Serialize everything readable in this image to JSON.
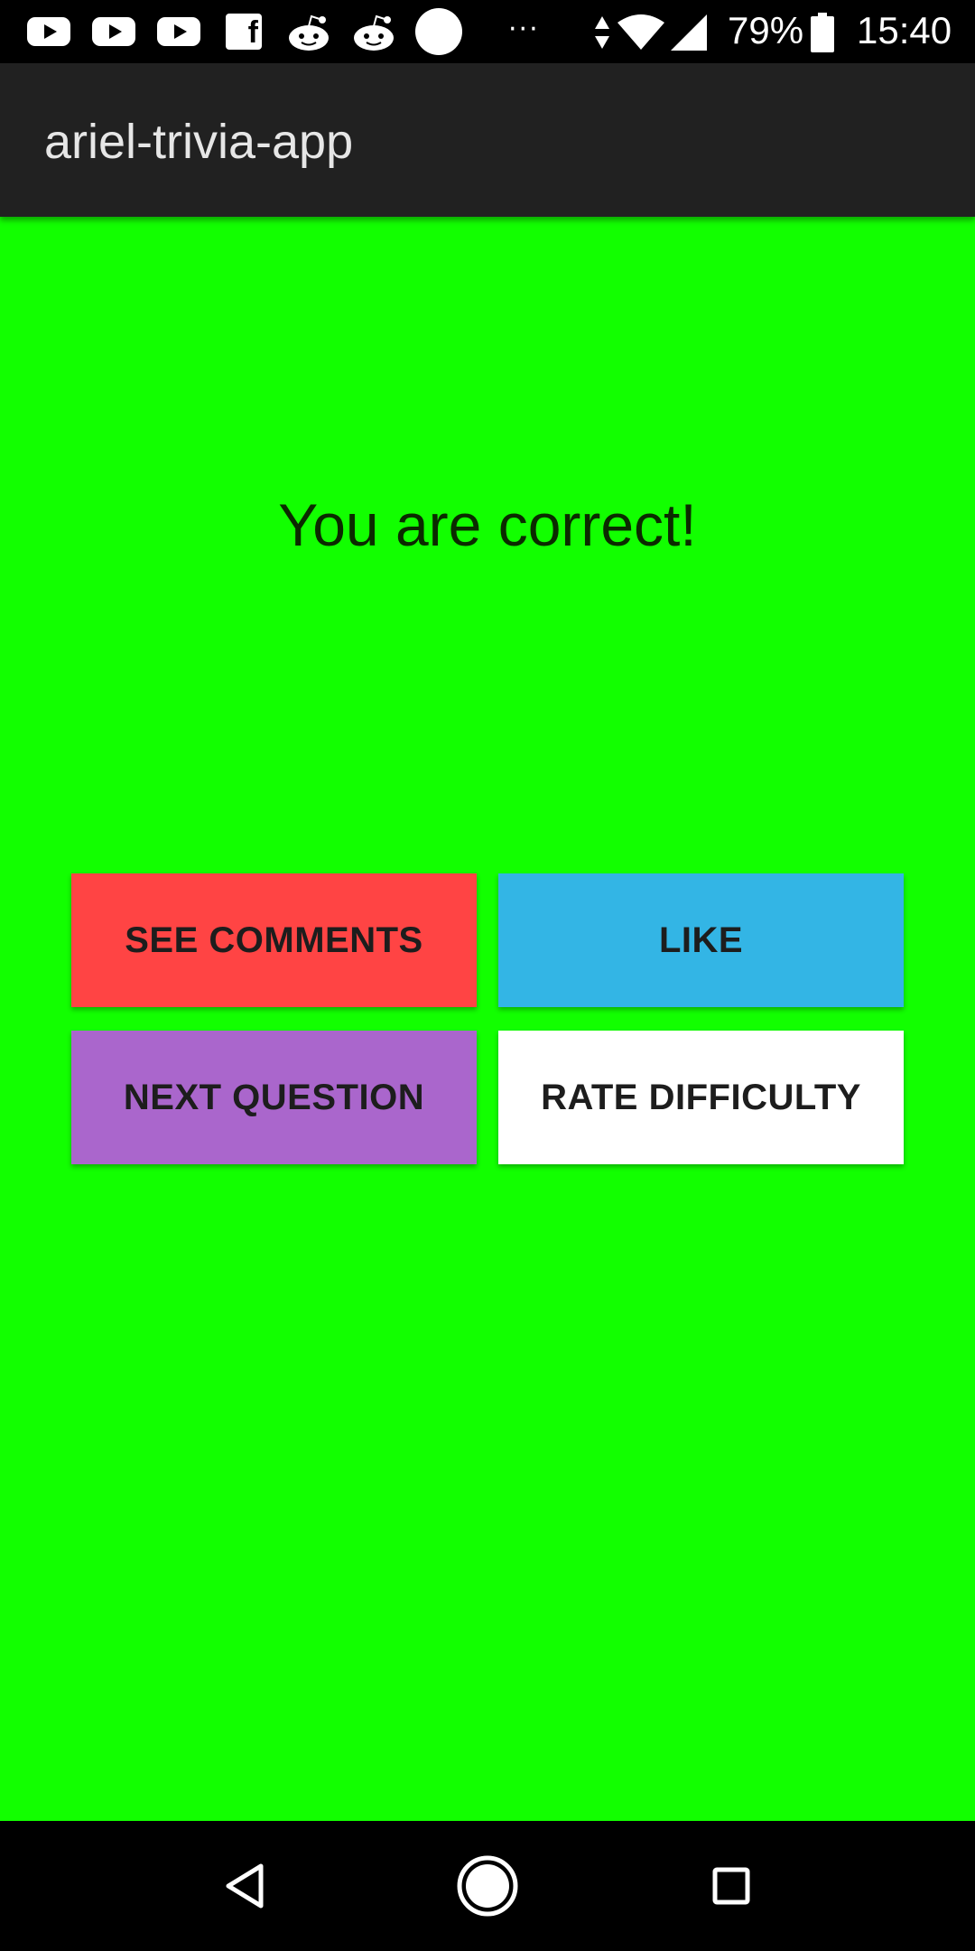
{
  "status_bar": {
    "icons": [
      "youtube-icon",
      "youtube-icon",
      "youtube-icon",
      "facebook-icon",
      "reddit-icon",
      "reddit-icon",
      "circle-icon",
      "more-dots-icon",
      "data-arrows-icon",
      "wifi-icon",
      "signal-icon",
      "battery-icon"
    ],
    "more_dots": "···",
    "facebook_letter": "f",
    "battery_percent": "79%",
    "time": "15:40"
  },
  "app_bar": {
    "title": "ariel-trivia-app"
  },
  "main": {
    "result_text": "You are correct!",
    "background_color": "#12ff00",
    "buttons": [
      {
        "label": "SEE COMMENTS",
        "color": "#ff4444"
      },
      {
        "label": "LIKE",
        "color": "#33b5e5"
      },
      {
        "label": "NEXT QUESTION",
        "color": "#aa66cc"
      },
      {
        "label": "RATE DIFFICULTY",
        "color": "#ffffff"
      }
    ]
  },
  "nav_bar": {
    "icons": [
      "back-icon",
      "home-icon",
      "recent-apps-icon"
    ]
  }
}
